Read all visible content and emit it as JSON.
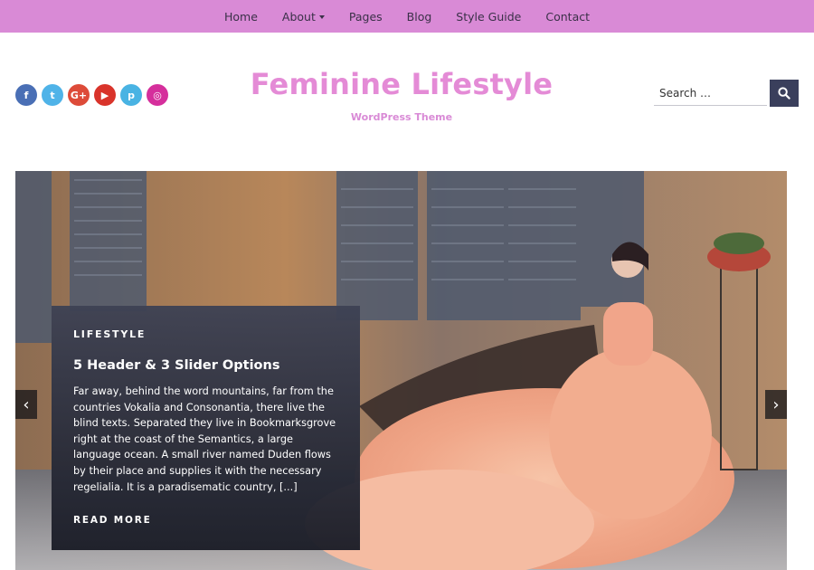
{
  "nav": {
    "items": [
      {
        "label": "Home"
      },
      {
        "label": "About",
        "has_dropdown": true
      },
      {
        "label": "Pages"
      },
      {
        "label": "Blog"
      },
      {
        "label": "Style Guide"
      },
      {
        "label": "Contact"
      }
    ],
    "background": "#d98ad6"
  },
  "social": [
    {
      "icon": "facebook-icon",
      "glyph": "f",
      "color": "#4a6fb5"
    },
    {
      "icon": "twitter-icon",
      "glyph": "t",
      "color": "#4fb3e8"
    },
    {
      "icon": "google-plus-icon",
      "glyph": "G+",
      "color": "#dd4b39"
    },
    {
      "icon": "youtube-icon",
      "glyph": "▶",
      "color": "#d9342b"
    },
    {
      "icon": "pinterest-icon",
      "glyph": "p",
      "color": "#49b3e3"
    },
    {
      "icon": "instagram-icon",
      "glyph": "◎",
      "color": "#d52f9c"
    }
  ],
  "header": {
    "title": "Feminine Lifestyle",
    "tagline": "WordPress Theme",
    "title_color": "#e48bd6"
  },
  "search": {
    "placeholder": "Search …"
  },
  "slider": {
    "category": "LIFESTYLE",
    "post_title": "5 Header & 3 Slider Options",
    "excerpt": "Far away, behind the word mountains, far from the countries Vokalia and Consonantia, there live the blind texts. Separated they live in Bookmarksgrove right at the coast of the Semantics, a large language ocean. A small river named Duden flows by their place and supplies it with the necessary regelialia. It is a paradisematic country, [...]",
    "read_more": "READ MORE",
    "prev_label": "‹",
    "next_label": "›"
  }
}
